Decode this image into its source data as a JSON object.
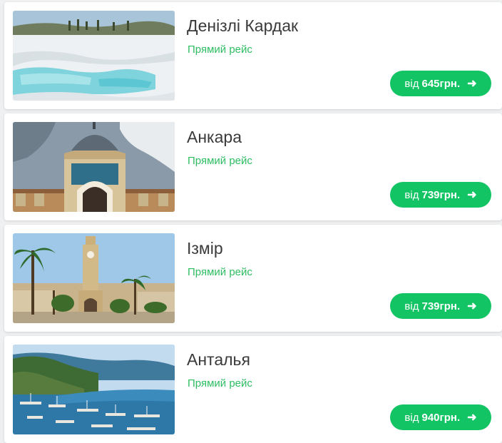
{
  "offers": [
    {
      "city": "Денізлі Кардак",
      "flight_type": "Прямий рейс",
      "price_prefix": "від",
      "price": "645грн.",
      "arrow": "➜",
      "image": "pamukkale-travertines-photo"
    },
    {
      "city": "Анкара",
      "flight_type": "Прямий рейс",
      "price_prefix": "від",
      "price": "739грн.",
      "arrow": "➜",
      "image": "ankara-domed-building-photo"
    },
    {
      "city": "Ізмір",
      "flight_type": "Прямий рейс",
      "price_prefix": "від",
      "price": "739грн.",
      "arrow": "➜",
      "image": "izmir-clock-tower-photo"
    },
    {
      "city": "Анталья",
      "flight_type": "Прямий рейс",
      "price_prefix": "від",
      "price": "940грн.",
      "arrow": "➜",
      "image": "antalya-harbor-photo"
    }
  ],
  "colors": {
    "accent": "#12c463",
    "flight_type_text": "#2ebd62",
    "city_text": "#3a3a3a"
  }
}
